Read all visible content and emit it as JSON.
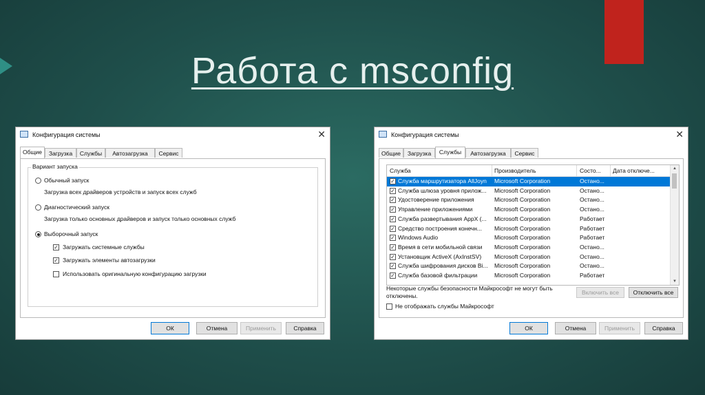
{
  "slide": {
    "title": "Работа с msconfig"
  },
  "dialog1": {
    "title": "Конфигурация системы",
    "tabs": [
      "Общие",
      "Загрузка",
      "Службы",
      "Автозагрузка",
      "Сервис"
    ],
    "active_tab": "Общие",
    "group_label": "Вариант запуска",
    "options": [
      {
        "label": "Обычный запуск",
        "desc": "Загрузка всех драйверов устройств и запуск всех служб",
        "selected": false
      },
      {
        "label": "Диагностический запуск",
        "desc": "Загрузка только основных драйверов и запуск только основных служб",
        "selected": false
      },
      {
        "label": "Выборочный запуск",
        "desc": "",
        "selected": true
      }
    ],
    "checkboxes": [
      {
        "label": "Загружать системные службы",
        "checked": true
      },
      {
        "label": "Загружать элементы автозагрузки",
        "checked": true
      },
      {
        "label": "Использовать оригинальную конфигурацию загрузки",
        "checked": false
      }
    ],
    "buttons": {
      "ok": "ОК",
      "cancel": "Отмена",
      "apply": "Применить",
      "help": "Справка"
    }
  },
  "dialog2": {
    "title": "Конфигурация системы",
    "tabs": [
      "Общие",
      "Загрузка",
      "Службы",
      "Автозагрузка",
      "Сервис"
    ],
    "active_tab": "Службы",
    "columns": [
      "Служба",
      "Производитель",
      "Состо...",
      "Дата отключе..."
    ],
    "rows": [
      {
        "name": "Служба маршрутизатора AllJoyn",
        "vendor": "Microsoft Corporation",
        "status": "Остано...",
        "checked": true,
        "selected": true
      },
      {
        "name": "Служба шлюза уровня прилож...",
        "vendor": "Microsoft Corporation",
        "status": "Остано...",
        "checked": true,
        "selected": false
      },
      {
        "name": "Удостоверение приложения",
        "vendor": "Microsoft Corporation",
        "status": "Остано...",
        "checked": true,
        "selected": false
      },
      {
        "name": "Управление приложениями",
        "vendor": "Microsoft Corporation",
        "status": "Остано...",
        "checked": true,
        "selected": false
      },
      {
        "name": "Служба развертывания AppX (...",
        "vendor": "Microsoft Corporation",
        "status": "Работает",
        "checked": true,
        "selected": false
      },
      {
        "name": "Средство построения конечн...",
        "vendor": "Microsoft Corporation",
        "status": "Работает",
        "checked": true,
        "selected": false
      },
      {
        "name": "Windows Audio",
        "vendor": "Microsoft Corporation",
        "status": "Работает",
        "checked": true,
        "selected": false
      },
      {
        "name": "Время в сети мобильной связи",
        "vendor": "Microsoft Corporation",
        "status": "Остано...",
        "checked": true,
        "selected": false
      },
      {
        "name": "Установщик ActiveX (AxInstSV)",
        "vendor": "Microsoft Corporation",
        "status": "Остано...",
        "checked": true,
        "selected": false
      },
      {
        "name": "Служба шифрования дисков Bi...",
        "vendor": "Microsoft Corporation",
        "status": "Остано...",
        "checked": true,
        "selected": false
      },
      {
        "name": "Служба базовой фильтрации",
        "vendor": "Microsoft Corporation",
        "status": "Работает",
        "checked": true,
        "selected": false
      }
    ],
    "note": "Некоторые службы безопасности Майкрософт не могут быть отключены.",
    "enable_all": "Включить все",
    "disable_all": "Отключить все",
    "hide_ms_label": "Не отображать службы Майкрософт",
    "buttons": {
      "ok": "ОК",
      "cancel": "Отмена",
      "apply": "Применить",
      "help": "Справка"
    }
  }
}
